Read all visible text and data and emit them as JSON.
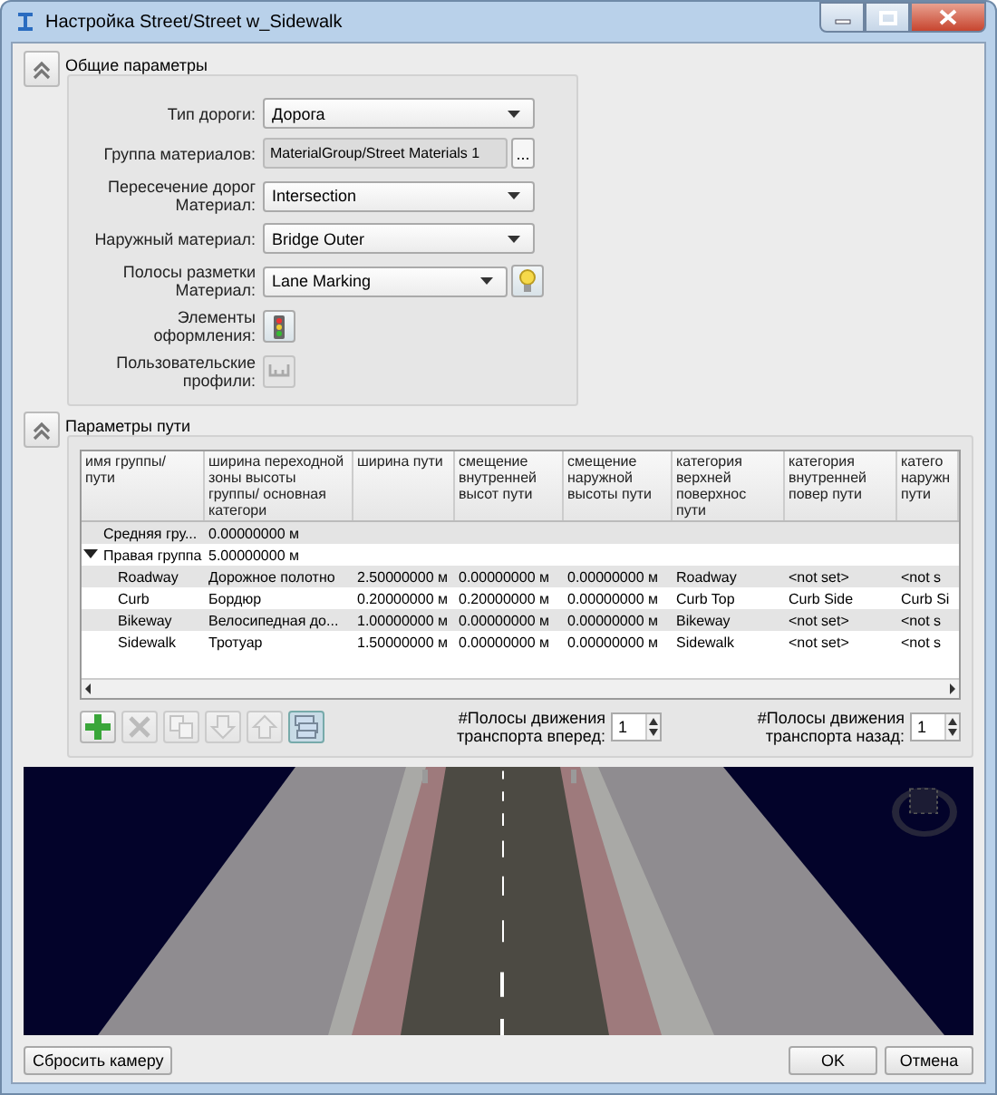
{
  "window": {
    "title": "Настройка Street/Street w_Sidewalk"
  },
  "general": {
    "title": "Общие параметры",
    "collapsed": false,
    "fields": [
      {
        "kind": "dropdown",
        "label": "Тип дороги:",
        "value": "Дорога"
      },
      {
        "kind": "browse",
        "label": "Группа материалов:",
        "value": "MaterialGroup/Street Materials 1",
        "button": "..."
      },
      {
        "kind": "dropdown",
        "label": "Пересечение дорог Материал:",
        "value": "Intersection"
      },
      {
        "kind": "dropdown",
        "label": "Наружный материал:",
        "value": "Bridge Outer"
      },
      {
        "kind": "dropdown-bulb",
        "label": "Полосы разметки Материал:",
        "value": "Lane Marking"
      },
      {
        "kind": "icon-traffic",
        "label": "Элементы оформления:",
        "disabled": false
      },
      {
        "kind": "icon-profile",
        "label": "Пользовательские профили:",
        "disabled": true
      }
    ]
  },
  "path": {
    "title": "Параметры пути",
    "collapsed": false,
    "table": {
      "columns": [
        "имя группы/ пути",
        "ширина переходной зоны высоты группы/ основная категори",
        "ширина пути",
        "смещение внутренней высот пути",
        "смещение наружной высоты пути",
        "категория верхней поверхнос пути",
        "категория внутренней повер пути",
        "катего наружн пути"
      ],
      "rows": [
        {
          "name": "Средняя гру...",
          "cells": [
            "0.00000000 м"
          ]
        },
        {
          "name": "Правая группа",
          "cells": [
            "5.00000000 м"
          ],
          "expanded": true,
          "children": [
            {
              "name": "Roadway",
              "cells": [
                "Дорожное полотно",
                "2.50000000 м",
                "0.00000000 м",
                "0.00000000 м",
                "Roadway",
                "<not set>",
                "<not s"
              ]
            },
            {
              "name": "Curb",
              "cells": [
                "Бордюр",
                "0.20000000 м",
                "0.20000000 м",
                "0.00000000 м",
                "Curb Top",
                "Curb Side",
                "Curb Si"
              ]
            },
            {
              "name": "Bikeway",
              "cells": [
                "Велосипедная до...",
                "1.00000000 м",
                "0.00000000 м",
                "0.00000000 м",
                "Bikeway",
                "<not set>",
                "<not s"
              ]
            },
            {
              "name": "Sidewalk",
              "cells": [
                "Тротуар",
                "1.50000000 м",
                "0.00000000 м",
                "0.00000000 м",
                "Sidewalk",
                "<not set>",
                "<not s"
              ]
            }
          ]
        }
      ]
    },
    "tools": [
      {
        "kind": "add",
        "disabled": false,
        "pressed": false
      },
      {
        "kind": "delete",
        "disabled": true,
        "pressed": false
      },
      {
        "kind": "copy",
        "disabled": true,
        "pressed": false
      },
      {
        "kind": "down",
        "disabled": true,
        "pressed": false
      },
      {
        "kind": "up",
        "disabled": true,
        "pressed": false
      },
      {
        "kind": "layers",
        "disabled": false,
        "pressed": true
      }
    ],
    "spinners": [
      {
        "label": "#Полосы движения транспорта вперед:",
        "value": "1"
      },
      {
        "label": "#Полосы движения транспорта назад:",
        "value": "1"
      }
    ]
  },
  "buttons": [
    {
      "label": "Сбросить камеру",
      "kind": "left"
    },
    {
      "label": "OK",
      "kind": "right"
    },
    {
      "label": "Отмена",
      "kind": "right"
    }
  ]
}
